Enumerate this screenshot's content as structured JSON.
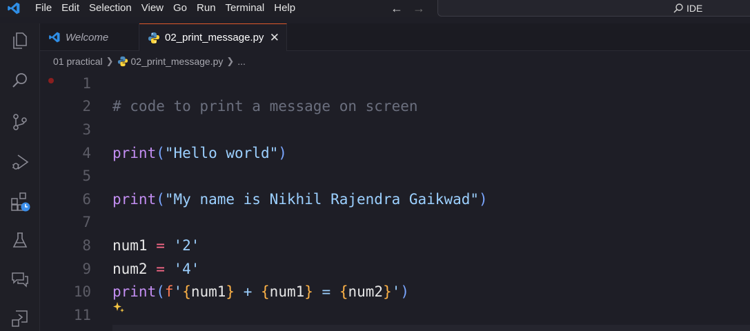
{
  "menu": [
    "File",
    "Edit",
    "Selection",
    "View",
    "Go",
    "Run",
    "Terminal",
    "Help"
  ],
  "command_center": {
    "text": "IDE"
  },
  "tabs": [
    {
      "label": "Welcome"
    },
    {
      "label": "02_print_message.py",
      "active": true
    }
  ],
  "breadcrumb": {
    "folder": "01 practical",
    "file": "02_print_message.py",
    "more": "..."
  },
  "editor": {
    "line_numbers": [
      "1",
      "2",
      "3",
      "4",
      "5",
      "6",
      "7",
      "8",
      "9",
      "10",
      "11"
    ],
    "lines": [
      [],
      [
        {
          "t": "comment",
          "v": "# code to print a message on screen"
        }
      ],
      [],
      [
        {
          "t": "fn",
          "v": "print"
        },
        {
          "t": "paren",
          "v": "("
        },
        {
          "t": "str",
          "v": "\"Hello world\""
        },
        {
          "t": "paren",
          "v": ")"
        }
      ],
      [],
      [
        {
          "t": "fn",
          "v": "print"
        },
        {
          "t": "paren",
          "v": "("
        },
        {
          "t": "str",
          "v": "\"My name is Nikhil Rajendra Gaikwad\""
        },
        {
          "t": "paren",
          "v": ")"
        }
      ],
      [],
      [
        {
          "t": "var",
          "v": "num1"
        },
        {
          "t": "op",
          "v": " = "
        },
        {
          "t": "str",
          "v": "'2'"
        }
      ],
      [
        {
          "t": "var",
          "v": "num2"
        },
        {
          "t": "op",
          "v": " = "
        },
        {
          "t": "str",
          "v": "'4'"
        }
      ],
      [
        {
          "t": "fn",
          "v": "print"
        },
        {
          "t": "paren",
          "v": "("
        },
        {
          "t": "f",
          "v": "f"
        },
        {
          "t": "str",
          "v": "'"
        },
        {
          "t": "brace",
          "v": "{"
        },
        {
          "t": "var",
          "v": "num1"
        },
        {
          "t": "brace",
          "v": "}"
        },
        {
          "t": "str",
          "v": " + "
        },
        {
          "t": "brace",
          "v": "{"
        },
        {
          "t": "var",
          "v": "num1"
        },
        {
          "t": "brace",
          "v": "}"
        },
        {
          "t": "str",
          "v": " = "
        },
        {
          "t": "brace",
          "v": "{"
        },
        {
          "t": "var",
          "v": "num2"
        },
        {
          "t": "brace",
          "v": "}"
        },
        {
          "t": "str",
          "v": "'"
        },
        {
          "t": "paren",
          "v": ")"
        }
      ],
      []
    ]
  },
  "icons": {
    "activity": [
      "explorer-icon",
      "search-icon",
      "source-control-icon",
      "run-debug-icon",
      "extensions-icon",
      "testing-icon",
      "chat-icon",
      "remote-icon"
    ]
  },
  "colors": {
    "accent": "#e05a2b",
    "background": "#1e1e26"
  }
}
